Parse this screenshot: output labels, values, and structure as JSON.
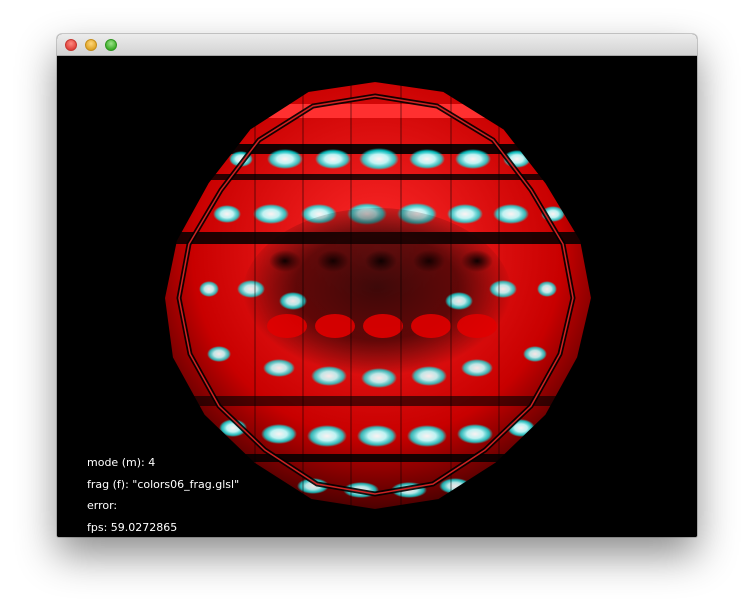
{
  "window": {
    "title": ""
  },
  "hud": {
    "mode_line": "mode (m): 4",
    "frag_line": "frag (f): \"colors06_frag.glsl\"",
    "error_line": "error:",
    "fps_line": "fps: 59.0272865"
  },
  "colors": {
    "background": "#000000",
    "primary": "#ff0000",
    "secondary": "#00ffff",
    "highlight": "#ffffff"
  }
}
